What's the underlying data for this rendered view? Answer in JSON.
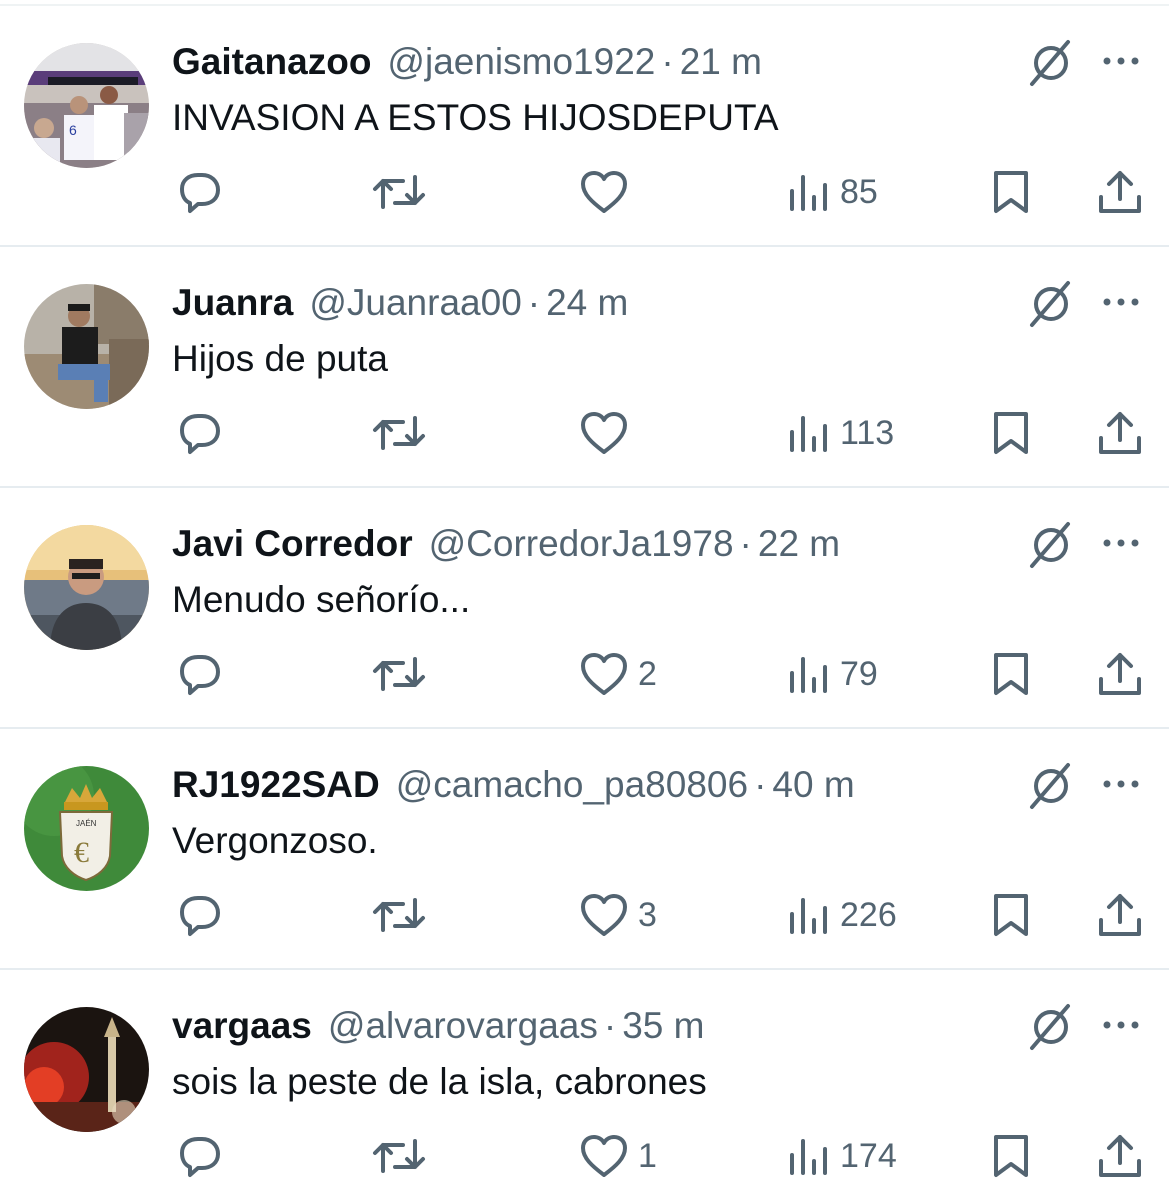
{
  "tweets": [
    {
      "name": "Gaitanazoo",
      "handle": "@jaenismo1922",
      "separator": "·",
      "time": "21 m",
      "text": "INVASION A ESTOS HIJOSDEPUTA",
      "likes": "",
      "views": "85"
    },
    {
      "name": "Juanra",
      "handle": "@Juanraa00",
      "separator": "·",
      "time": "24 m",
      "text": "Hijos de puta",
      "likes": "",
      "views": "113"
    },
    {
      "name": "Javi Corredor",
      "handle": "@CorredorJa1978",
      "separator": "·",
      "time": "22 m",
      "text": "Menudo señorío...",
      "likes": "2",
      "views": "79"
    },
    {
      "name": "RJ1922SAD",
      "handle": "@camacho_pa80806",
      "separator": "·",
      "time": "40 m",
      "text": "Vergonzoso.",
      "likes": "3",
      "views": "226"
    },
    {
      "name": "vargaas",
      "handle": "@alvarovargaas",
      "separator": "·",
      "time": "35 m",
      "text": "sois la peste de la isla, cabrones",
      "likes": "1",
      "views": "174"
    }
  ],
  "icons": {
    "reply": "reply-icon",
    "retweet": "retweet-icon",
    "like": "heart-icon",
    "views": "views-icon",
    "bookmark": "bookmark-icon",
    "share": "share-icon",
    "grok": "grok-icon",
    "more": "more-icon"
  },
  "colors": {
    "text": "#0f1419",
    "secondary": "#536471",
    "divider": "#e6ecf0"
  }
}
